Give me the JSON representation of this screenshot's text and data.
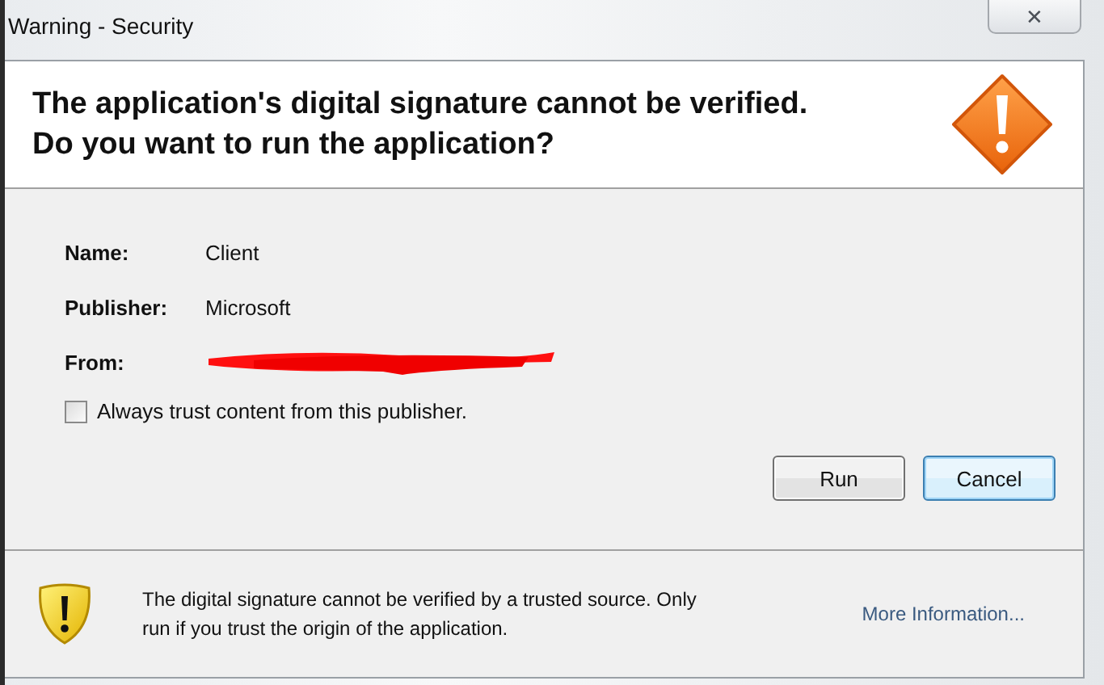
{
  "window": {
    "title": "Warning - Security",
    "close_label": "✕"
  },
  "heading": [
    "The application's digital signature cannot be verified.",
    "Do you want to run the application?"
  ],
  "fields": [
    {
      "label": "Name:",
      "value": "Client",
      "kind": "text"
    },
    {
      "label": "Publisher:",
      "value": "Microsoft",
      "kind": "text"
    },
    {
      "label": "From:",
      "kind": "redacted"
    }
  ],
  "trust_checkbox": {
    "label": "Always trust content from this publisher.",
    "checked": false
  },
  "buttons": [
    {
      "label": "Run",
      "focused": false
    },
    {
      "label": "Cancel",
      "focused": true
    }
  ],
  "footer": {
    "message": "The digital signature cannot be verified by a trusted source.  Only run if you trust the origin of the application.",
    "link": "More Information..."
  }
}
